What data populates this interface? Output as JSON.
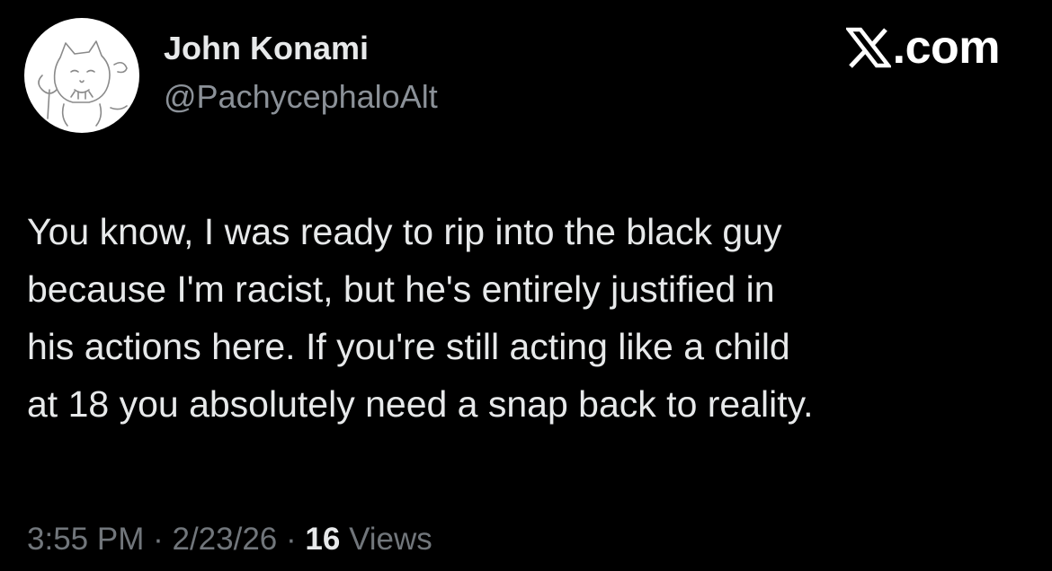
{
  "author": {
    "display_name": "John Konami",
    "handle": "@PachycephaloAlt"
  },
  "brand": {
    "logo_icon": "x-logo-icon",
    "suffix": ".com"
  },
  "tweet": {
    "lines": [
      "You know, I was ready to rip into the black guy",
      "because I'm racist, but he's entirely justified in",
      "his actions here. If you're still acting like a child",
      "at 18 you absolutely need a snap back to reality."
    ]
  },
  "meta": {
    "time": "3:55 PM",
    "separator": "·",
    "date": "2/23/26",
    "views_count": "16",
    "views_label": "Views"
  },
  "colors": {
    "background": "#000000",
    "primary_text": "#e7e9ea",
    "secondary_text": "#71767b"
  }
}
